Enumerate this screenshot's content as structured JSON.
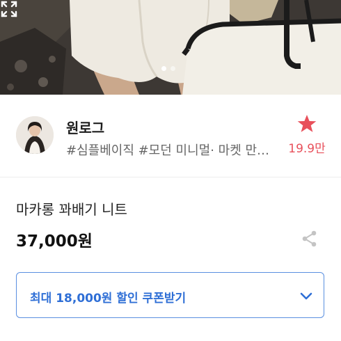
{
  "gallery": {
    "current_index": 1,
    "total": 2,
    "expand_icon": "expand-icon"
  },
  "seller": {
    "name": "원로그",
    "tags": "#심플베이직 #모던 미니멀· 마켓 만…",
    "like_icon": "star-icon",
    "like_count": "19.9만",
    "accent_color": "#e8505b"
  },
  "product": {
    "name": "마카롱 꽈배기 니트",
    "price": "37,000원",
    "share_icon": "share-icon"
  },
  "coupon": {
    "label": "최대 18,000원 할인 쿠폰받기",
    "icon": "chevron-down-icon",
    "color": "#2f6fd6"
  }
}
